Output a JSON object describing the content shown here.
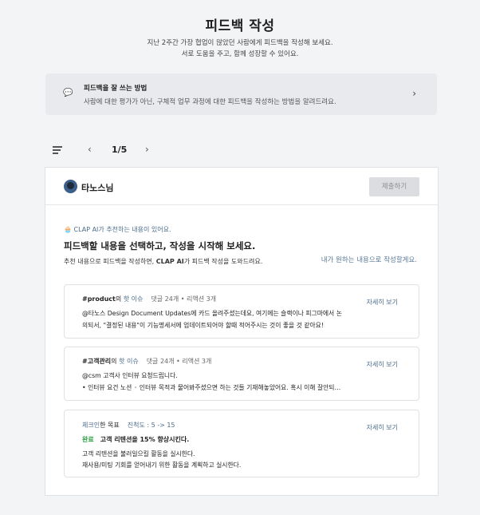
{
  "header": {
    "title": "피드백 작성",
    "subtitle_line1": "지난 2주간 가장 협업이 많았던 사람에게 피드백을 작성해 보세요.",
    "subtitle_line2": "서로 도움을 주고, 함께 성장할 수 있어요."
  },
  "tip": {
    "icon": "speech-bubble-icon",
    "title": "피드백을 잘 쓰는 방법",
    "description": "사람에 대한 평가가 아닌, 구체적 업무 과정에 대한 피드백을 작성하는 방법을 알려드려요."
  },
  "pager": {
    "current": "1/5"
  },
  "card": {
    "username": "타노스님",
    "submit_label": "제출하기",
    "ai_tag": "CLAP AI가 추천하는 내용이 있어요.",
    "headline": "피드백할 내용을 선택하고, 작성을 시작해 보세요.",
    "desc_prefix": "추천 내용으로 피드백을 작성하면, ",
    "desc_brand": "CLAP AI",
    "desc_suffix": "가 피드백 작성을 도와드려요.",
    "self_write": "내가 원하는 내용으로 작성할게요.",
    "detail_label": "자세히 보기",
    "items": [
      {
        "tag": "#product",
        "of": "의 ",
        "hot": "핫 이슈",
        "counts": "댓글 24개 • 리액션 3개",
        "line1": "@타노스 Design Document Updates에 카드 올려주셨는데요, 여기에는 슬랙이나 피그마에서 논",
        "line2": "의되서, \"결정된 내용\"이 기능명세서에 업데이트되어야 할때 적어주시는 것이 좋을 것 같아요!"
      },
      {
        "tag": "#고객관리",
        "of": "의 ",
        "hot": "핫 이슈",
        "counts": "댓글 24개 • 리액션 3개",
        "line1": "@csm 고객사 인터뷰 요청드립니다.",
        "line2": "• 인터뷰 요건 노션 ◦ 인터뷰 목적과 물어봐주셨으면 하는 것들 기재해놓았어요. 혹시 이해 잘안되…"
      }
    ],
    "kr": {
      "checkin": "체크인",
      "goal": "한 목표",
      "progress": "진척도 : 5 -> 15",
      "status": "완료",
      "title": "고객 리텐션을 15% 향상시킨다.",
      "line1": "고객 리텐션을 불러일으킬 활동을 실시한다.",
      "line2": "재사용/미팅 기회를 얻어내기 위한 활동을 계획하고 실시한다."
    }
  },
  "colors": {
    "accent": "#4a6b8c",
    "success": "#2f9e44",
    "background": "#f3f4f6"
  }
}
